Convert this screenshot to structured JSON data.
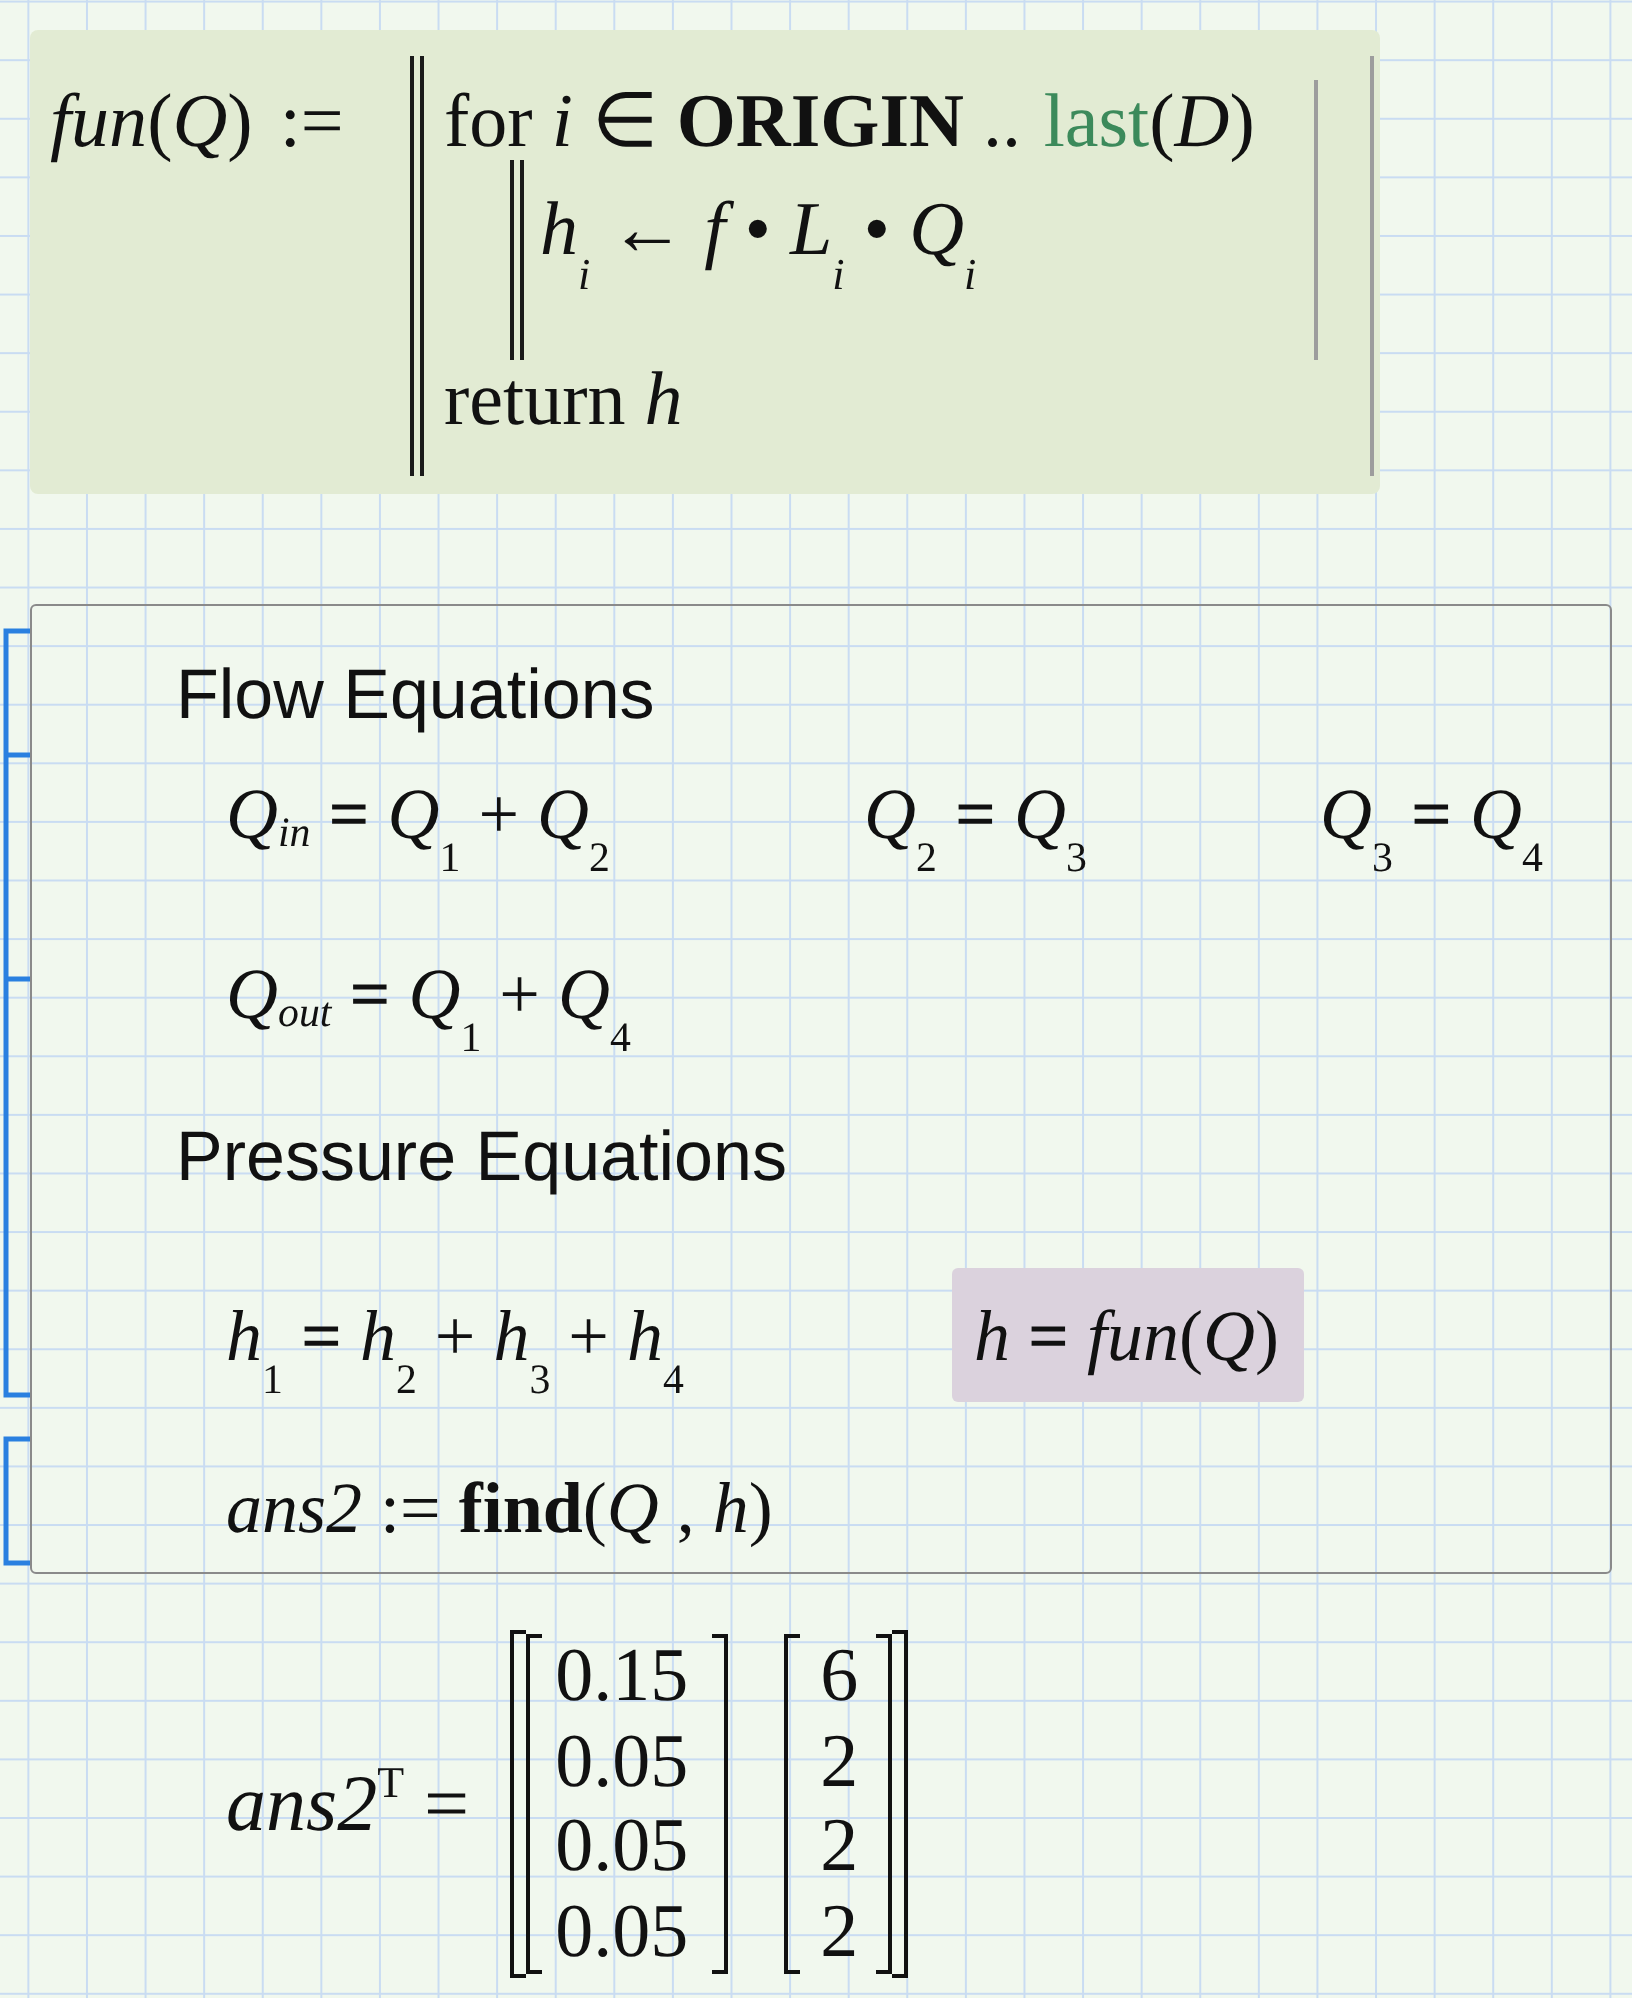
{
  "program": {
    "definition": "*fun*(*Q*) :=",
    "statements": [
      {
        "segments": [
          {
            "kind": "plain",
            "text": "for *i* ∈ **ORIGIN** .."
          },
          {
            "kind": "builtin",
            "text": "last"
          },
          {
            "kind": "plain",
            "text": "(*D*)"
          }
        ],
        "children": [
          {
            "segments": [
              {
                "kind": "plain",
                "text": "*h*$_{i}$ ← *f* • *L*$_{i}$ • *Q*$_{i}$"
              }
            ]
          }
        ]
      },
      {
        "segments": [
          {
            "kind": "plain",
            "text": "return *h*"
          }
        ]
      }
    ]
  },
  "solve_block": {
    "sections": [
      {
        "heading": "Flow Equations",
        "rows": [
          {
            "equations": [
              {
                "text": "*Q$_{in}$* **=** *Q*$_{1}$ + *Q*$_{2}$",
                "highlighted": false
              },
              {
                "text": "*Q*$_{2}$ **=** *Q*$_{3}$",
                "highlighted": false
              },
              {
                "text": "*Q*$_{3}$ **=** *Q*$_{4}$",
                "highlighted": false
              }
            ]
          },
          {
            "equations": [
              {
                "text": "*Q$_{out}$* **=** *Q*$_{1}$ + *Q*$_{4}$",
                "highlighted": false
              }
            ]
          }
        ]
      },
      {
        "heading": "Pressure Equations",
        "rows": [
          {
            "equations": [
              {
                "text": "*h*$_{1}$ **=** *h*$_{2}$ + *h*$_{3}$ + *h*$_{4}$",
                "highlighted": false
              },
              {
                "text": "*h* **=** *fun*(*Q*)",
                "highlighted": true
              }
            ]
          }
        ]
      }
    ],
    "solver": "*ans2* := **find**(*Q* , *h*)"
  },
  "result": {
    "expression": "*ans2*$^{T}$ =",
    "columns": [
      {
        "values": [
          "0.15",
          "0.05",
          "0.05",
          "0.05"
        ]
      },
      {
        "values": [
          "6",
          "2",
          "2",
          "2"
        ]
      }
    ]
  }
}
